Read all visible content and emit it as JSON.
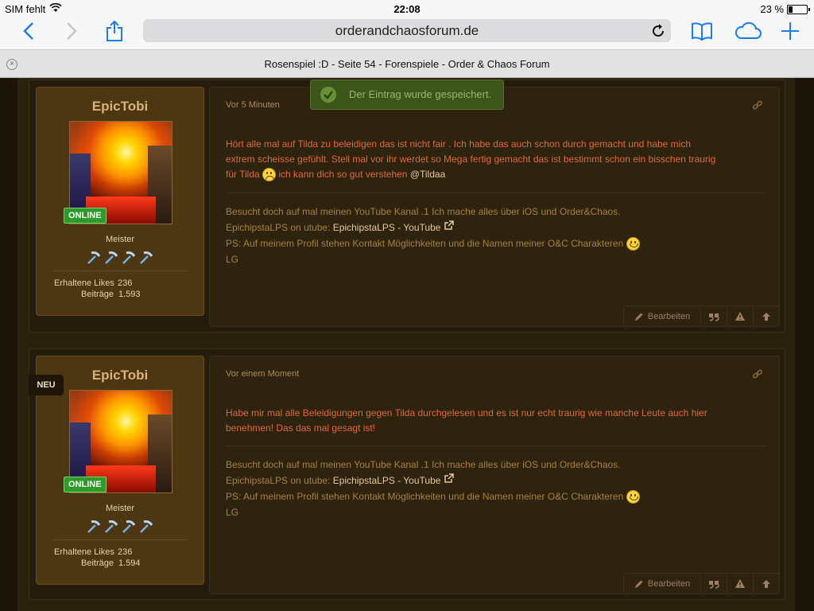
{
  "status_bar": {
    "carrier": "SIM fehlt",
    "time": "22:08",
    "battery": "23 %"
  },
  "browser": {
    "url": "orderandchaosforum.de",
    "tab_title": "Rosenspiel :D - Seite 54 - Forenspiele - Order & Chaos Forum",
    "icons": {
      "back": "chevron-left-icon",
      "forward": "chevron-right-icon",
      "share": "share-icon",
      "reload": "reload-icon",
      "bookmarks": "book-icon",
      "cloud": "cloud-icon",
      "new_tab": "plus-icon"
    }
  },
  "toast": {
    "message": "Der Eintrag wurde gespeichert."
  },
  "posts": [
    {
      "user": {
        "name": "EpicTobi",
        "online_badge": "ONLINE",
        "rank": "Meister",
        "likes_label": "Erhaltene Likes",
        "likes": "236",
        "posts_label": "Beiträge",
        "posts": "1.593"
      },
      "time": "Vor 5 Minuten",
      "message": {
        "line1": "Hört alle mal auf Tilda zu beleidigen das ist nicht fair . Ich habe das auch schon durch gemacht und habe mich",
        "line2": "extrem scheisse gefühlt. Stell mal vor ihr werdet so Mega fertig gemacht das ist bestimmt schon ein bisschen traurig",
        "line3_pre": "für Tilda",
        "line3_post": "ich kann dich so gut verstehen",
        "mention": "@Tildaa"
      },
      "signature": {
        "line1": "Besucht doch auf mal meinen YouTube Kanal .1 Ich mache alles über iOS und Order&Chaos.",
        "line2_pre": "EpichipstaLPS on utube:",
        "line2_link": "EpichipstaLPS - YouTube",
        "line3": "PS: Auf meinem Profil stehen Kontakt Möglichkeiten und die Namen meiner O&C Charakteren",
        "line4": "LG"
      },
      "actions": {
        "edit": "Bearbeiten"
      }
    },
    {
      "badge": "NEU",
      "user": {
        "name": "EpicTobi",
        "online_badge": "ONLINE",
        "rank": "Meister",
        "likes_label": "Erhaltene Likes",
        "likes": "236",
        "posts_label": "Beiträge",
        "posts": "1.594"
      },
      "time": "Vor einem Moment",
      "message": {
        "line1": "Habe mir mal alle Beleidigungen gegen Tilda durchgelesen und es ist nur echt traurig wie manche Leute auch hier",
        "line2": "benehmen! Das das mal gesagt ist!"
      },
      "signature": {
        "line1": "Besucht doch auf mal meinen YouTube Kanal .1 Ich mache alles über iOS und Order&Chaos.",
        "line2_pre": "EpichipstaLPS on utube:",
        "line2_link": "EpichipstaLPS - YouTube",
        "line3": "PS: Auf meinem Profil stehen Kontakt Möglichkeiten und die Namen meiner O&C Charakteren",
        "line4": "LG"
      },
      "actions": {
        "edit": "Bearbeiten"
      }
    }
  ],
  "colors": {
    "accent_text": "#e06a3a",
    "signature_text": "#a9813c",
    "username": "#d8b27a",
    "online_badge": "#2e9a2a",
    "card_bg": "#4d3612"
  }
}
